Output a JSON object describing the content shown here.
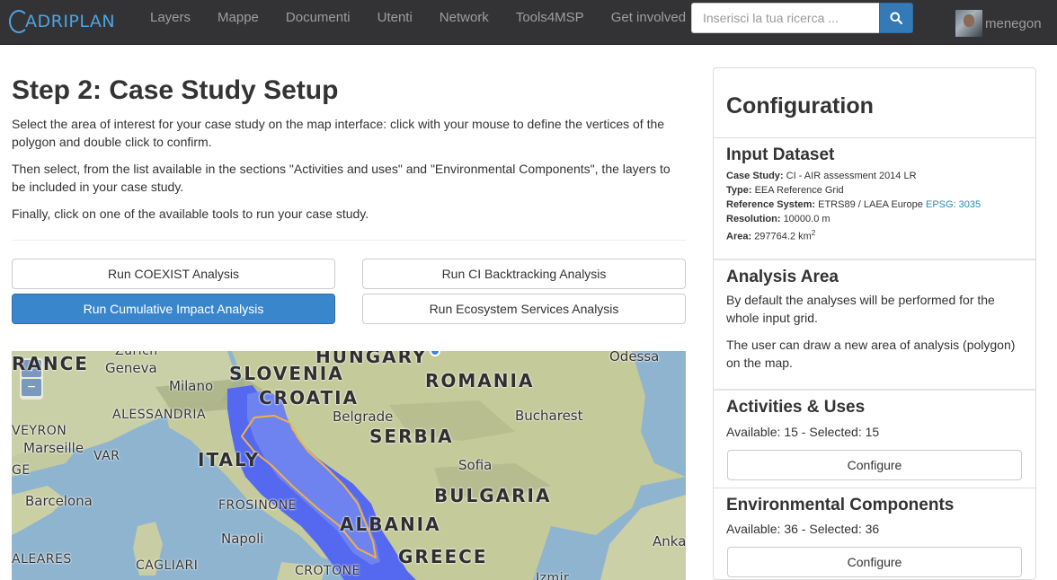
{
  "navbar": {
    "brand": "ADRIPLAN",
    "items": [
      "Layers",
      "Mappe",
      "Documenti",
      "Utenti",
      "Network",
      "Tools4MSP",
      "Get involved"
    ],
    "search_placeholder": "Inserisci la tua ricerca ...",
    "user_name": "menegon"
  },
  "main": {
    "title": "Step 2: Case Study Setup",
    "paragraphs": [
      "Select the area of interest for your case study on the map interface: click with your mouse to define the vertices of the polygon and double click to confirm.",
      "Then select, from the list available in the sections \"Activities and uses\" and \"Environmental Components\", the layers to be included in your case study.",
      "Finally, click on one of the available tools to run your case study."
    ],
    "buttons": {
      "coexist": "Run COEXIST Analysis",
      "ci_backtracking": "Run CI Backtracking Analysis",
      "cumulative_impact": "Run Cumulative Impact Analysis",
      "ecosystem_services": "Run Ecosystem Services Analysis"
    }
  },
  "map": {
    "zoom_in": "+",
    "zoom_out": "−",
    "labels": {
      "france": "RANCE",
      "zurich": "Zurich",
      "geneva": "Geneva",
      "hungary": "HUNGARY",
      "odessa": "Odessa",
      "slovenia": "SLOVENIA",
      "milano": "Milano",
      "croatia": "CROATIA",
      "romania": "ROMANIA",
      "alessandria": "ALESSANDRIA",
      "belgrade": "Belgrade",
      "bucharest": "Bucharest",
      "aveyron": "VEYRON",
      "marseille": "Marseille",
      "var": "VAR",
      "italy": "ITALY",
      "serbia": "SERBIA",
      "sofia": "Sofia",
      "ge": "GE",
      "barcelona": "Barcelona",
      "frosinone": "FROSINONE",
      "bulgaria": "BULGARIA",
      "albania": "ALBANIA",
      "napoli": "Napoli",
      "ankara": "Anka",
      "baleares": "ALEARES",
      "cagliari": "CAGLIARI",
      "crotone": "CROTONE",
      "greece": "GREECE",
      "izmir": "Izmir"
    }
  },
  "sidebar": {
    "title": "Configuration",
    "input_dataset": {
      "title": "Input Dataset",
      "case_study_label": "Case Study:",
      "case_study_value": "CI - AIR assessment 2014 LR",
      "type_label": "Type:",
      "type_value": "EEA Reference Grid",
      "ref_label": "Reference System:",
      "ref_value": "ETRS89 / LAEA Europe",
      "ref_link": "EPSG: 3035",
      "resolution_label": "Resolution:",
      "resolution_value": "10000.0 m",
      "area_label": "Area:",
      "area_value": "297764.2 km",
      "area_sup": "2"
    },
    "analysis_area": {
      "title": "Analysis Area",
      "text1": "By default the analyses will be performed for the whole input grid.",
      "text2": "The user can draw a new area of analysis (polygon) on the map."
    },
    "activities": {
      "title": "Activities & Uses",
      "status": "Available: 15 - Selected: 15",
      "button": "Configure"
    },
    "environmental": {
      "title": "Environmental Components",
      "status": "Available: 36 - Selected: 36",
      "button": "Configure"
    }
  }
}
